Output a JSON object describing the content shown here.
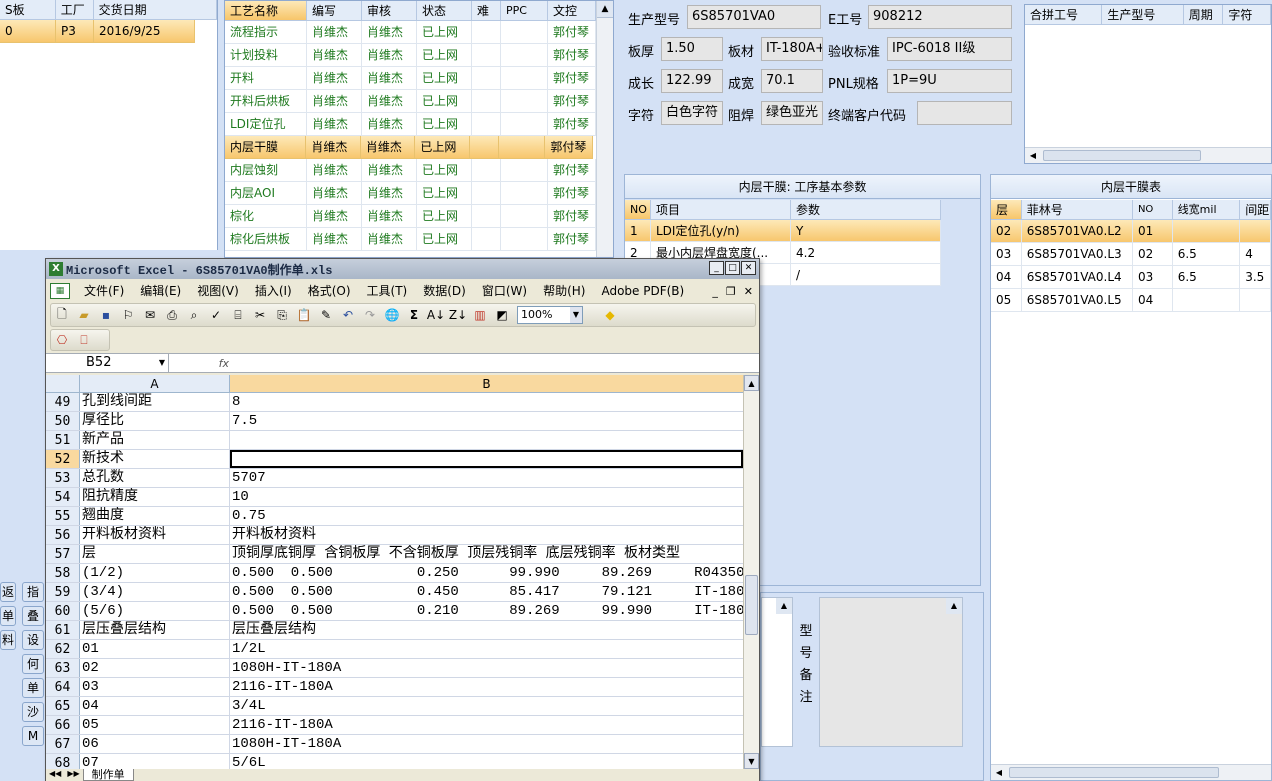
{
  "left_list": {
    "headers": [
      "S板",
      "工厂",
      "交货日期"
    ],
    "rows": [
      {
        "s": "0",
        "factory": "P3",
        "date": "2016/9/25"
      }
    ]
  },
  "process_grid": {
    "headers": [
      "工艺名称",
      "编写",
      "审核",
      "状态",
      "难",
      "PPC",
      "文控"
    ],
    "rows": [
      {
        "name": "流程指示",
        "writer": "肖维杰",
        "reviewer": "肖维杰",
        "status": "已上网",
        "ctrl": "郭付琴"
      },
      {
        "name": "计划投料",
        "writer": "肖维杰",
        "reviewer": "肖维杰",
        "status": "已上网",
        "ctrl": "郭付琴"
      },
      {
        "name": "开料",
        "writer": "肖维杰",
        "reviewer": "肖维杰",
        "status": "已上网",
        "ctrl": "郭付琴"
      },
      {
        "name": "开料后烘板",
        "writer": "肖维杰",
        "reviewer": "肖维杰",
        "status": "已上网",
        "ctrl": "郭付琴"
      },
      {
        "name": "LDI定位孔",
        "writer": "肖维杰",
        "reviewer": "肖维杰",
        "status": "已上网",
        "ctrl": "郭付琴"
      },
      {
        "name": "内层干膜",
        "writer": "肖维杰",
        "reviewer": "肖维杰",
        "status": "已上网",
        "ctrl": "郭付琴"
      },
      {
        "name": "内层蚀刻",
        "writer": "肖维杰",
        "reviewer": "肖维杰",
        "status": "已上网",
        "ctrl": "郭付琴"
      },
      {
        "name": "内层AOI",
        "writer": "肖维杰",
        "reviewer": "肖维杰",
        "status": "已上网",
        "ctrl": "郭付琴"
      },
      {
        "name": "棕化",
        "writer": "肖维杰",
        "reviewer": "肖维杰",
        "status": "已上网",
        "ctrl": "郭付琴"
      },
      {
        "name": "棕化后烘板",
        "writer": "肖维杰",
        "reviewer": "肖维杰",
        "status": "已上网",
        "ctrl": "郭付琴"
      }
    ]
  },
  "info": {
    "model_label": "生产型号",
    "model_value": "6S85701VA0",
    "eno_label": "E工号",
    "eno_value": "908212",
    "thick_label": "板厚",
    "thick_value": "1.50",
    "material_label": "板材",
    "material_value": "IT-180A+",
    "accept_label": "验收标准",
    "accept_value": "IPC-6018 II级",
    "length_label": "成长",
    "length_value": "122.99",
    "width_label": "成宽",
    "width_value": "70.1",
    "pnl_label": "PNL规格",
    "pnl_value": "1P=9U",
    "char_label": "字符",
    "char_value": "白色字符",
    "mask_label": "阻焊",
    "mask_value": "绿色亚光",
    "cust_label": "终端客户代码",
    "cust_value": ""
  },
  "merge_grid": {
    "headers": [
      "合拼工号",
      "生产型号",
      "周期",
      "字符"
    ]
  },
  "params": {
    "title": "内层干膜: 工序基本参数",
    "headers": [
      "NO",
      "项目",
      "参数"
    ],
    "rows": [
      {
        "no": "1",
        "item": "LDI定位孔(y/n)",
        "val": "Y"
      },
      {
        "no": "2",
        "item": "最小内层焊盘宽度(...",
        "val": "4.2"
      },
      {
        "no": "",
        "item": "",
        "val": "/"
      }
    ]
  },
  "film_table": {
    "title": "内层干膜表",
    "headers": [
      "层",
      "菲林号",
      "NO",
      "线宽mil",
      "间距"
    ],
    "rows": [
      {
        "layer": "02",
        "film": "6S85701VA0.L2",
        "no": "01",
        "lw": "",
        "gap": ""
      },
      {
        "layer": "03",
        "film": "6S85701VA0.L3",
        "no": "02",
        "lw": "6.5",
        "gap": "4"
      },
      {
        "layer": "04",
        "film": "6S85701VA0.L4",
        "no": "03",
        "lw": "6.5",
        "gap": "3.5"
      },
      {
        "layer": "05",
        "film": "6S85701VA0.L5",
        "no": "04",
        "lw": "",
        "gap": ""
      }
    ]
  },
  "remark": {
    "label_chars": [
      "型",
      "号",
      "备",
      "注"
    ]
  },
  "left_buttons": [
    "返",
    "指",
    "单",
    "叠",
    "设",
    "何",
    "单",
    "沙",
    "M",
    "料"
  ],
  "excel": {
    "title": "Microsoft Excel - 6S85701VA0制作单.xls",
    "menu": [
      "文件(F)",
      "编辑(E)",
      "视图(V)",
      "插入(I)",
      "格式(O)",
      "工具(T)",
      "数据(D)",
      "窗口(W)",
      "帮助(H)",
      "Adobe PDF(B)"
    ],
    "zoom": "100%",
    "namebox": "B52",
    "fx": "fx",
    "col_a": "A",
    "col_b": "B",
    "sheet_tab": "制作单",
    "rows": [
      {
        "n": "49",
        "a": "孔到线间距",
        "b": "8"
      },
      {
        "n": "50",
        "a": "厚径比",
        "b": "7.5"
      },
      {
        "n": "51",
        "a": "新产品",
        "b": ""
      },
      {
        "n": "52",
        "a": "新技术",
        "b": ""
      },
      {
        "n": "53",
        "a": "总孔数",
        "b": "5707"
      },
      {
        "n": "54",
        "a": "阻抗精度",
        "b": "10"
      },
      {
        "n": "55",
        "a": "翘曲度",
        "b": "0.75"
      },
      {
        "n": "56",
        "a": "开料板材资料",
        "b": "开料板材资料"
      },
      {
        "n": "57",
        "a": "层",
        "b": "顶铜厚底铜厚 含铜板厚 不含铜板厚 顶层残铜率 底层残铜率 板材类型"
      },
      {
        "n": "58",
        "a": "(1/2)",
        "b": "0.500  0.500          0.250      99.990     89.269     R04350B"
      },
      {
        "n": "59",
        "a": "(3/4)",
        "b": "0.500  0.500          0.450      85.417     79.121     IT-180A"
      },
      {
        "n": "60",
        "a": "(5/6)",
        "b": "0.500  0.500          0.210      89.269     99.990     IT-180A"
      },
      {
        "n": "61",
        "a": "层压叠层结构",
        "b": "层压叠层结构"
      },
      {
        "n": "62",
        "a": "01",
        "b": "1/2L"
      },
      {
        "n": "63",
        "a": "02",
        "b": "1080H-IT-180A"
      },
      {
        "n": "64",
        "a": "03",
        "b": "2116-IT-180A"
      },
      {
        "n": "65",
        "a": "04",
        "b": "3/4L"
      },
      {
        "n": "66",
        "a": "05",
        "b": "2116-IT-180A"
      },
      {
        "n": "67",
        "a": "06",
        "b": "1080H-IT-180A"
      },
      {
        "n": "68",
        "a": "07",
        "b": "5/6L"
      }
    ]
  }
}
